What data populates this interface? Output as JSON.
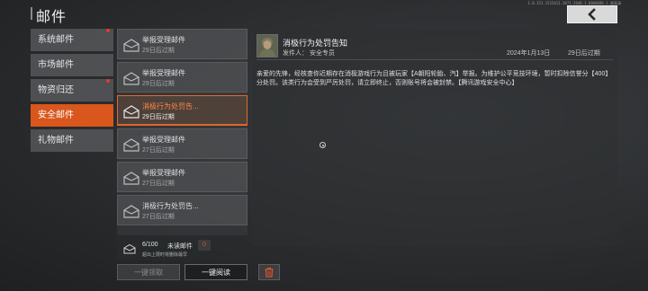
{
  "header": {
    "title": "邮件",
    "version": "1.0.151.1515411.2071.2640.1.6060606.1.超高清"
  },
  "sidebar": {
    "items": [
      {
        "label": "系统邮件",
        "dot": true
      },
      {
        "label": "市场邮件",
        "dot": false
      },
      {
        "label": "物资归还",
        "dot": true
      },
      {
        "label": "安全邮件",
        "dot": false,
        "active": true
      },
      {
        "label": "礼物邮件",
        "dot": false
      }
    ]
  },
  "mails": [
    {
      "subject": "举报受理邮件",
      "expiry": "29日后过期"
    },
    {
      "subject": "举报受理邮件",
      "expiry": "29日后过期"
    },
    {
      "subject": "消极行为处罚告...",
      "expiry": "29日后过期",
      "active": true
    },
    {
      "subject": "举报受理邮件",
      "expiry": "27日后过期"
    },
    {
      "subject": "举报受理邮件",
      "expiry": "27日后过期"
    },
    {
      "subject": "消极行为处罚告...",
      "expiry": "27日后过期"
    }
  ],
  "counter": {
    "count": "6/100",
    "label": "未读邮件",
    "unread": "0",
    "note": "超出上限时将删除最早"
  },
  "buttons": {
    "claim_all": "一键领取",
    "read_all": "一键阅读"
  },
  "detail": {
    "title": "消极行为处罚告知",
    "sender_label": "发件人：",
    "sender": "安全专员",
    "date": "2024年1月13日",
    "expiry": "29日后过期",
    "body": "亲爱的先锋，经核查你近期存在消极游戏行为且被玩家【A朝阳轮胎、汽】举报。为维护公平竞技环境，暂时扣除信誉分【400】分处罚。该类行为会受到严厉处罚，请立即终止，否则账号将会被封禁。【腾讯游戏安全中心】"
  },
  "colors": {
    "accent": "#d9561c",
    "alert_dot": "#e53a2a",
    "delete_icon": "#e0562a"
  }
}
